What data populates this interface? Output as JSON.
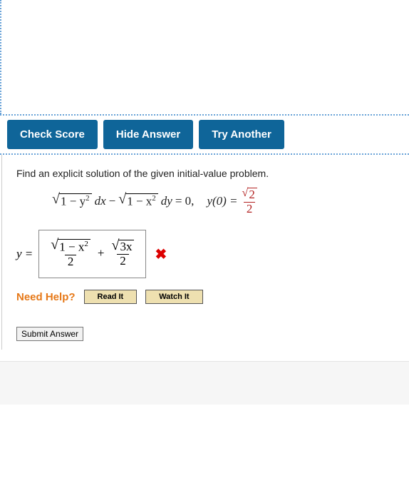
{
  "toolbar": {
    "check_score": "Check Score",
    "hide_answer": "Hide Answer",
    "try_another": "Try Another"
  },
  "problem": {
    "prompt": "Find an explicit solution of the given initial-value problem.",
    "equation": {
      "sqrt1_arg": "1 − y",
      "sqrt1_exp": "2",
      "dx": " dx",
      "minus": " − ",
      "sqrt2_arg": "1 − x",
      "sqrt2_exp": "2",
      "dy": " dy",
      "equals_zero": " = 0,",
      "ic_label": "y(0) = ",
      "ic_num_sqrt_arg": "2",
      "ic_den": "2"
    },
    "answer": {
      "y_equals": "y = ",
      "term1_num_sqrt_arg": "1 − x",
      "term1_num_sqrt_exp": "2",
      "term1_den": "2",
      "plus": " + ",
      "term2_num_sqrt_arg": "3x",
      "term2_den": "2",
      "incorrect_icon": "✖"
    }
  },
  "help": {
    "label": "Need Help?",
    "read_it": "Read It",
    "watch_it": "Watch It"
  },
  "submit": {
    "label": "Submit Answer"
  }
}
